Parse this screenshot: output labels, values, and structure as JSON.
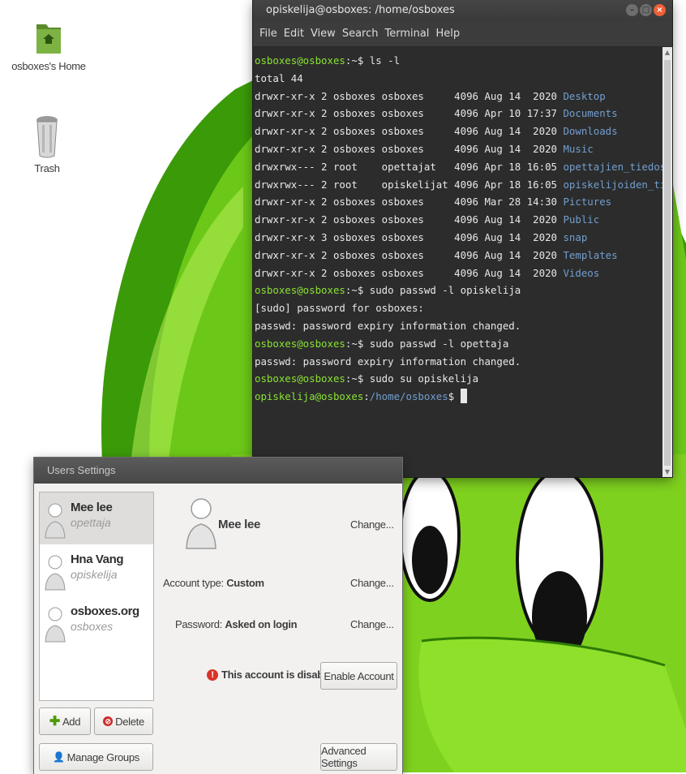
{
  "desktop": {
    "icons": [
      {
        "label": "osboxes's Home",
        "icon": "home-folder-icon"
      },
      {
        "label": "Trash",
        "icon": "trash-icon"
      }
    ]
  },
  "terminal": {
    "title": "opiskelija@osboxes: /home/osboxes",
    "menu": [
      "File",
      "Edit",
      "View",
      "Search",
      "Terminal",
      "Help"
    ],
    "lines": [
      {
        "prompt": "osboxes@osboxes",
        "path": ":~$ ",
        "text": "ls -l"
      },
      {
        "text": "total 44"
      },
      {
        "text": "drwxr-xr-x 2 osboxes osboxes     4096 Aug 14  2020 ",
        "name": "Desktop"
      },
      {
        "text": "drwxr-xr-x 2 osboxes osboxes     4096 Apr 10 17:37 ",
        "name": "Documents"
      },
      {
        "text": "drwxr-xr-x 2 osboxes osboxes     4096 Aug 14  2020 ",
        "name": "Downloads"
      },
      {
        "text": "drwxr-xr-x 2 osboxes osboxes     4096 Aug 14  2020 ",
        "name": "Music"
      },
      {
        "text": "drwxrwx--- 2 root    opettajat   4096 Apr 18 16:05 ",
        "name": "opettajien_tiedostot"
      },
      {
        "text": "drwxrwx--- 2 root    opiskelijat 4096 Apr 18 16:05 ",
        "name": "opiskelijoiden_tiedostot"
      },
      {
        "text": "drwxr-xr-x 2 osboxes osboxes     4096 Mar 28 14:30 ",
        "name": "Pictures"
      },
      {
        "text": "drwxr-xr-x 2 osboxes osboxes     4096 Aug 14  2020 ",
        "name": "Public"
      },
      {
        "text": "drwxr-xr-x 3 osboxes osboxes     4096 Aug 14  2020 ",
        "name": "snap"
      },
      {
        "text": "drwxr-xr-x 2 osboxes osboxes     4096 Aug 14  2020 ",
        "name": "Templates"
      },
      {
        "text": "drwxr-xr-x 2 osboxes osboxes     4096 Aug 14  2020 ",
        "name": "Videos"
      },
      {
        "prompt": "osboxes@osboxes",
        "path": ":~$ ",
        "text": "sudo passwd -l opiskelija"
      },
      {
        "text": "[sudo] password for osboxes:"
      },
      {
        "text": "passwd: password expiry information changed."
      },
      {
        "prompt": "osboxes@osboxes",
        "path": ":~$ ",
        "text": "sudo passwd -l opettaja"
      },
      {
        "text": "passwd: password expiry information changed."
      },
      {
        "prompt": "osboxes@osboxes",
        "path": ":~$ ",
        "text": "sudo su opiskelija"
      },
      {
        "prompt": "opiskelija@osboxes",
        "path": ":",
        "cwd": "/home/osboxes",
        "text": "$ ",
        "cursor": true
      }
    ]
  },
  "users_settings": {
    "title": "Users Settings",
    "users": [
      {
        "name": "Mee lee",
        "username": "opettaja",
        "selected": true
      },
      {
        "name": "Hna Vang",
        "username": "opiskelija",
        "selected": false
      },
      {
        "name": "osboxes.org",
        "username": "osboxes",
        "selected": false
      }
    ],
    "detail": {
      "name": "Mee lee",
      "change_label": "Change...",
      "account_type_label": "Account type:",
      "account_type_value": "Custom",
      "password_label": "Password:",
      "password_value": "Asked on login",
      "disabled_message": "This account is disabled.",
      "enable_button": "Enable Account"
    },
    "buttons": {
      "add": "Add",
      "delete": "Delete",
      "manage_groups": "Manage Groups",
      "advanced": "Advanced Settings"
    }
  },
  "colors": {
    "prompt_green": "#8ae234",
    "dir_blue": "#729fcf",
    "wallpaper_green": "#7fd11f"
  }
}
